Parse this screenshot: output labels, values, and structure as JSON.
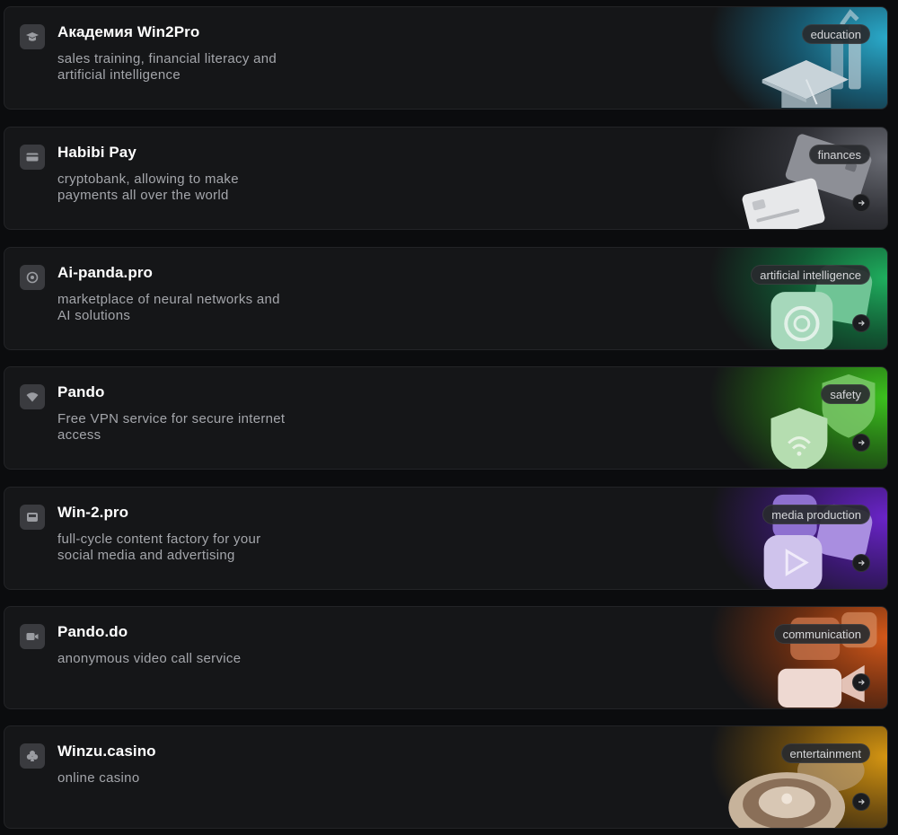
{
  "cards": [
    {
      "title": "Академия Win2Pro",
      "description": "sales training, financial literacy and artificial intelligence",
      "tag": "education",
      "icon": "graduation-cap-icon",
      "accent": "#2aa9c9",
      "has_arrow": false
    },
    {
      "title": "Habibi Pay",
      "description": "cryptobank, allowing to make payments all over the world",
      "tag": "finances",
      "icon": "credit-card-icon",
      "accent": "#6a6c74",
      "has_arrow": true
    },
    {
      "title": "Ai-panda.pro",
      "description": "marketplace of neural networks and AI solutions",
      "tag": "artificial intelligence",
      "icon": "ai-knot-icon",
      "accent": "#1fae5e",
      "has_arrow": true
    },
    {
      "title": "Pando",
      "description": "Free VPN service for secure internet access",
      "tag": "safety",
      "icon": "wifi-icon",
      "accent": "#3cc01e",
      "has_arrow": true
    },
    {
      "title": "Win-2.pro",
      "description": "full-cycle content factory for your social media and advertising",
      "tag": "media production",
      "icon": "media-icon",
      "accent": "#6a24c8",
      "has_arrow": true
    },
    {
      "title": "Pando.do",
      "description": "anonymous video call service",
      "tag": "communication",
      "icon": "video-camera-icon",
      "accent": "#d2581a",
      "has_arrow": true
    },
    {
      "title": "Winzu.casino",
      "description": "online casino",
      "tag": "entertainment",
      "icon": "club-suit-icon",
      "accent": "#d49512",
      "has_arrow": true
    }
  ]
}
